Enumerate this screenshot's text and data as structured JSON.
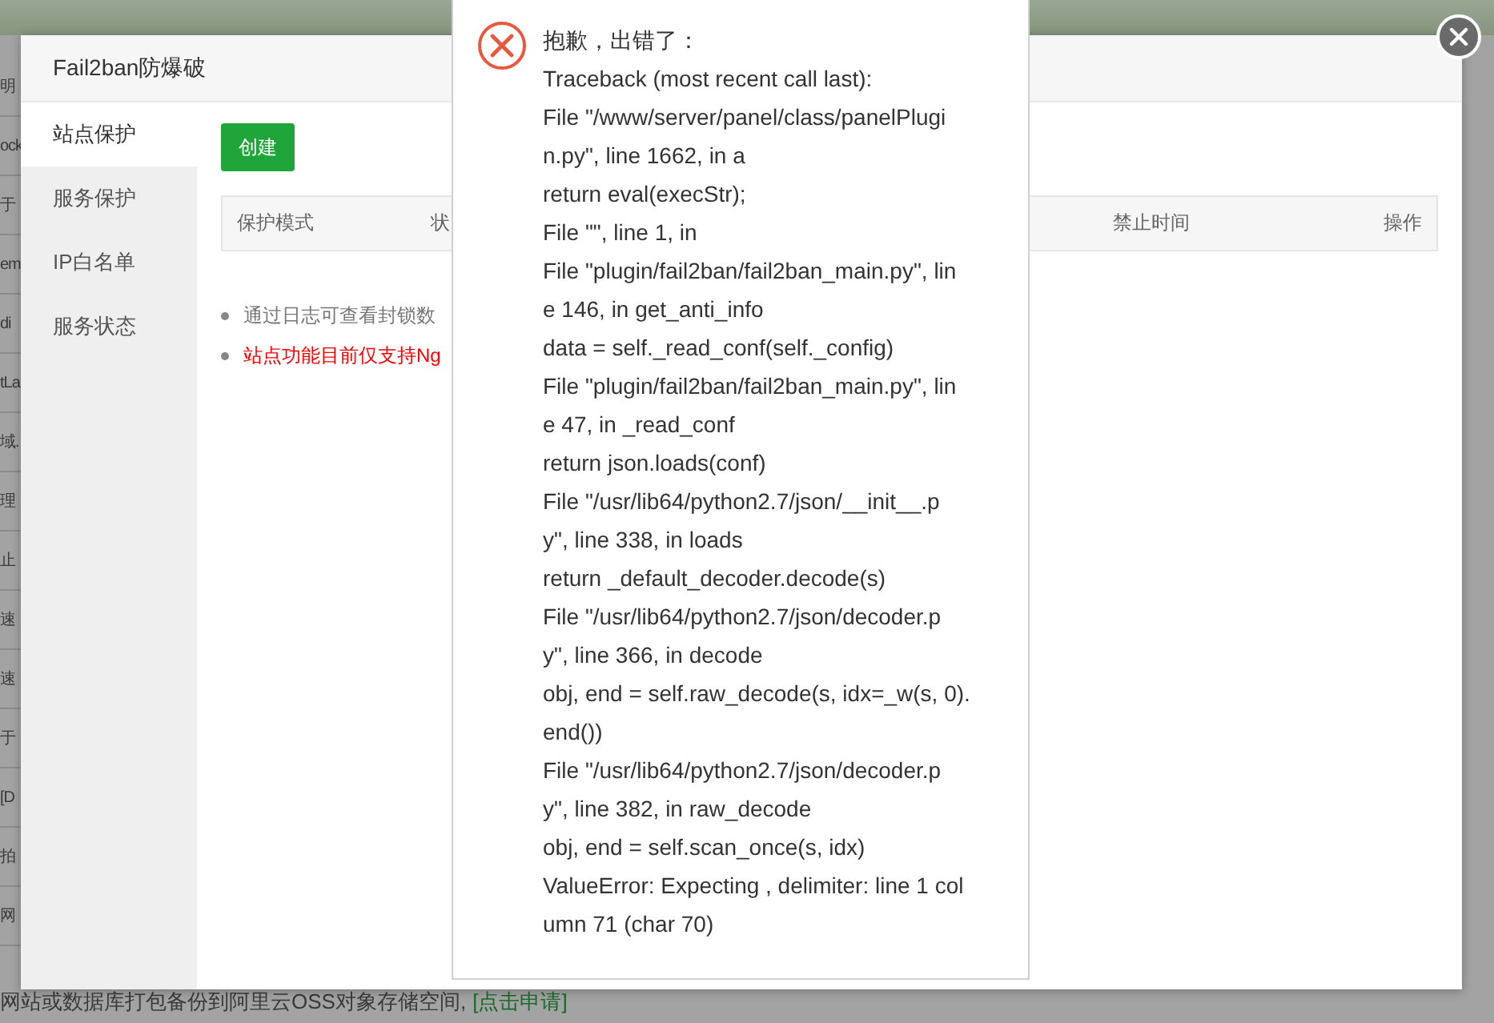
{
  "background_page": {
    "row_fragments": [
      "明",
      "ock",
      "于",
      "em",
      "di",
      "tLa",
      "域.",
      "理",
      "止",
      "速",
      "速",
      "于",
      "[D",
      "拍",
      "网"
    ],
    "footer": {
      "text": "网站或数据库打包备份到阿里云OSS对象存储空间,",
      "link": "[点击申请]"
    }
  },
  "modal": {
    "title": "Fail2ban防爆破",
    "sidebar": {
      "items": [
        {
          "label": "站点保护",
          "selected": true
        },
        {
          "label": "服务保护",
          "selected": false
        },
        {
          "label": "IP白名单",
          "selected": false
        },
        {
          "label": "服务状态",
          "selected": false
        }
      ]
    },
    "create_button": "创建",
    "table": {
      "columns": [
        "保护模式",
        "状",
        "禁止时间",
        "操作"
      ]
    },
    "notes": [
      {
        "text": "通过日志可查看封锁数",
        "kind": "normal"
      },
      {
        "text": "站点功能目前仅支持Ng",
        "kind": "warning"
      }
    ]
  },
  "error_dialog": {
    "lines": [
      "抱歉，出错了：",
      "Traceback (most recent call last):",
      "File \"/www/server/panel/class/panelPlugi",
      "n.py\", line 1662, in a",
      "return eval(execStr);",
      "File \"\", line 1, in",
      "File \"plugin/fail2ban/fail2ban_main.py\", lin",
      "e 146, in get_anti_info",
      "data = self._read_conf(self._config)",
      "File \"plugin/fail2ban/fail2ban_main.py\", lin",
      "e 47, in _read_conf",
      "return json.loads(conf)",
      "File \"/usr/lib64/python2.7/json/__init__.p",
      "y\", line 338, in loads",
      "return _default_decoder.decode(s)",
      "File \"/usr/lib64/python2.7/json/decoder.p",
      "y\", line 366, in decode",
      "obj, end = self.raw_decode(s, idx=_w(s, 0).",
      "end())",
      "File \"/usr/lib64/python2.7/json/decoder.p",
      "y\", line 382, in raw_decode",
      "obj, end = self.scan_once(s, idx)",
      "ValueError: Expecting , delimiter: line 1 col",
      "umn 71 (char 70)"
    ]
  }
}
